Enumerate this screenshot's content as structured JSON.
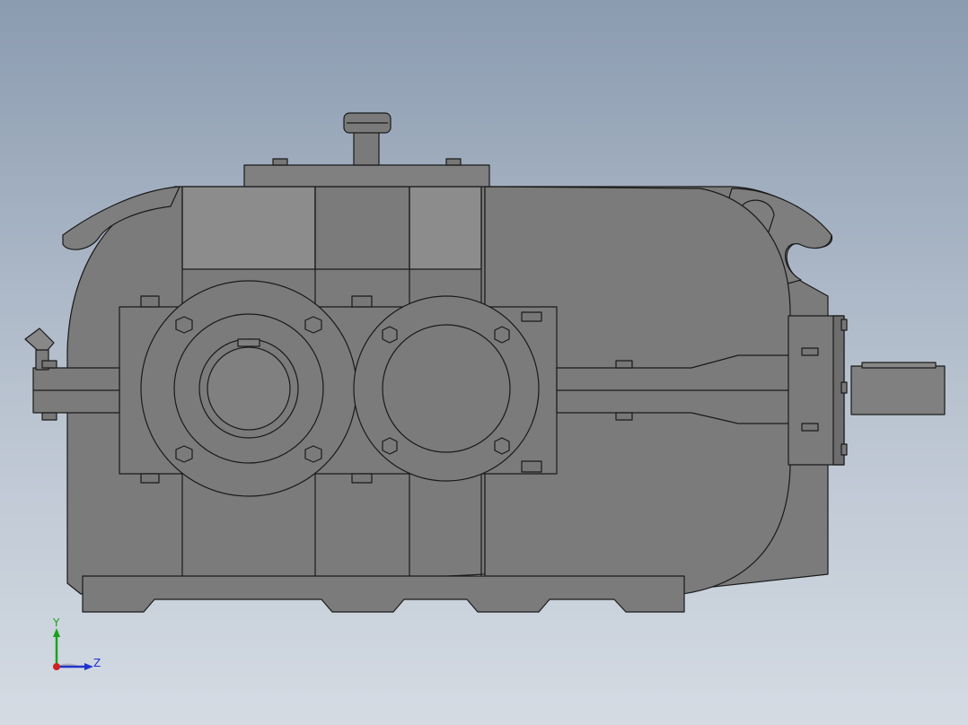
{
  "viewport": {
    "background_top": "#8b9bb0",
    "background_bottom": "#d4dbe3"
  },
  "model": {
    "body_color": "#7b7b7b",
    "body_light": "#8c8c8c",
    "edge_color": "#1a1a1a"
  },
  "triad": {
    "y_label": "Y",
    "z_label": "Z",
    "y_color": "#1aa31a",
    "z_color": "#2233cc",
    "x_color": "#cc2222"
  }
}
